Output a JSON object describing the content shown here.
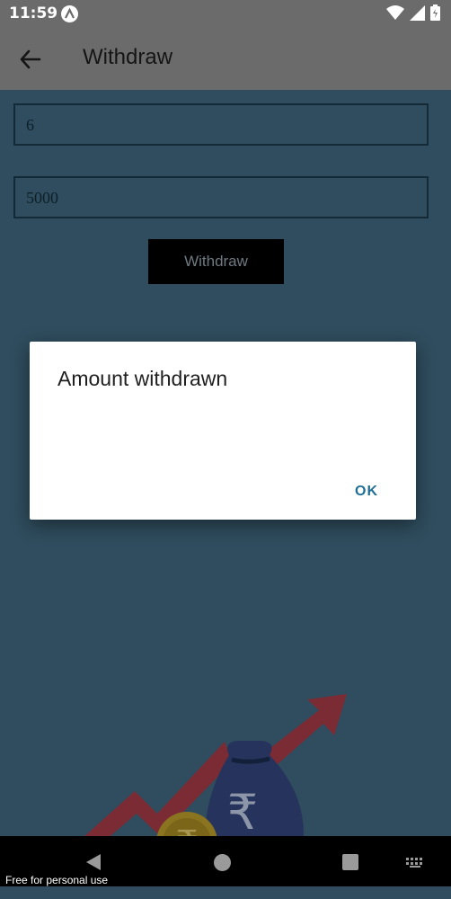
{
  "status_bar": {
    "time": "11:59",
    "notification_icon": "a-circle-icon"
  },
  "appbar": {
    "title": "Withdraw",
    "back_icon": "arrow-left-icon"
  },
  "form": {
    "field1_value": "6",
    "field2_value": "5000",
    "withdraw_button_label": "Withdraw"
  },
  "dialog": {
    "title": "Amount withdrawn",
    "ok_label": "OK"
  },
  "illustration": {
    "currency_symbol": "₹",
    "name": "money-bag-growth-illustration"
  },
  "nav_bar": {
    "watermark": "Free for personal use"
  },
  "colors": {
    "scrim": "#2f4d5e",
    "dialog_accent": "#1f6e94",
    "appbar": "#6b6b6b"
  }
}
